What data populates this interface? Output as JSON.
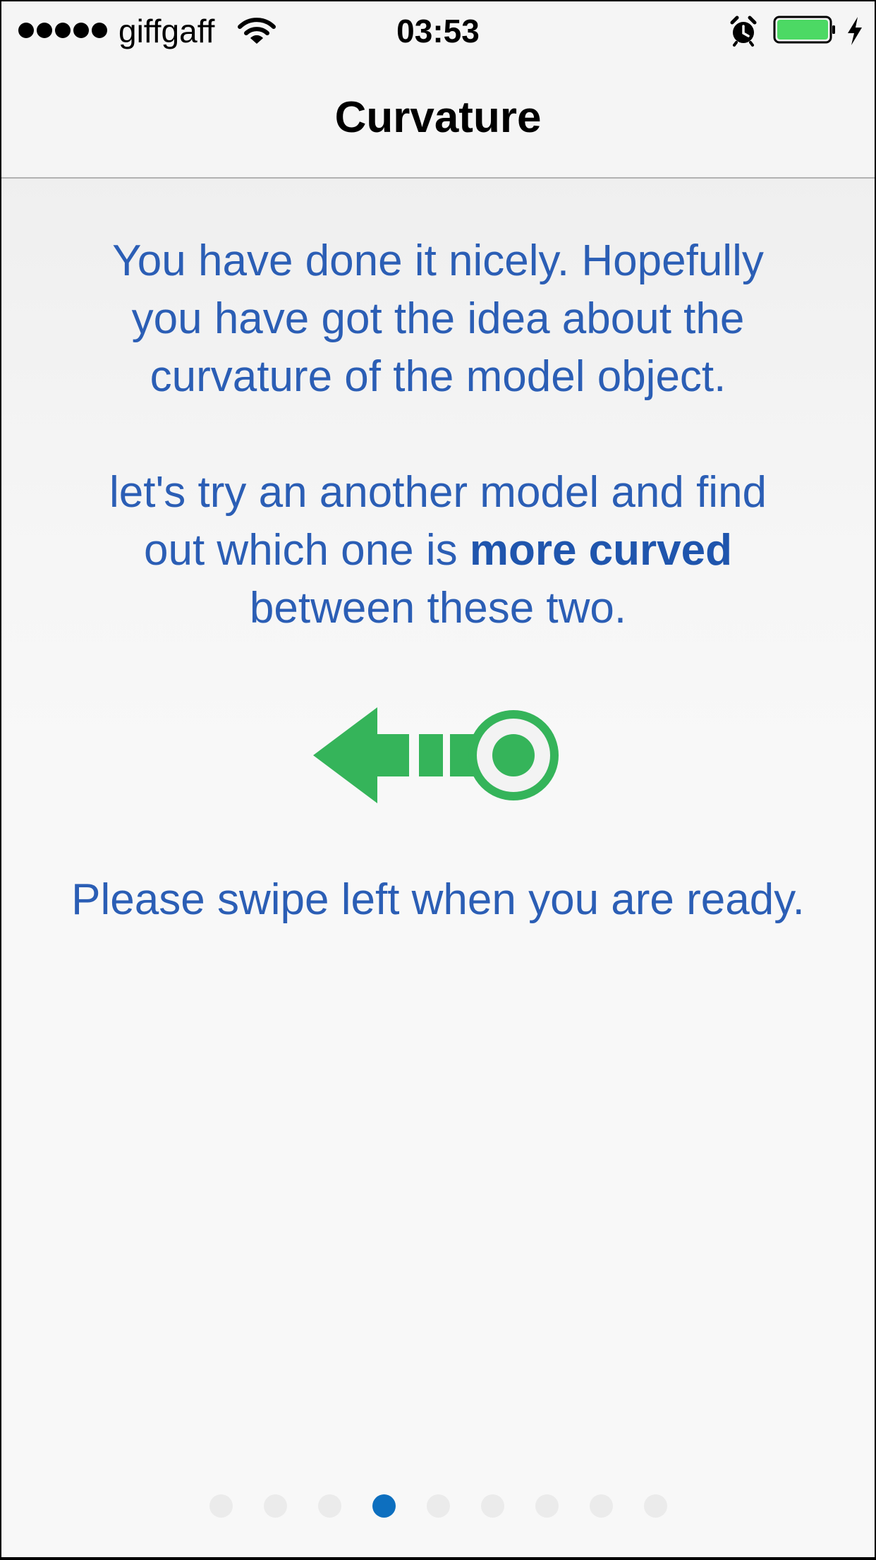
{
  "status_bar": {
    "carrier": "giffgaff",
    "time": "03:53",
    "signal_bars": 5,
    "battery_level": 1.0,
    "icons": [
      "signal-dots-icon",
      "wifi-icon",
      "alarm-clock-icon",
      "battery-icon",
      "charging-bolt-icon"
    ]
  },
  "nav": {
    "title": "Curvature"
  },
  "content": {
    "para1_line1": "You have done it nicely. Hopefully",
    "para1_line2": "you have got the idea about the",
    "para1_line3": "curvature of the model object.",
    "para2_line1": "let's try an another model and find",
    "para2_line2_prefix": "out which one is ",
    "para2_line2_bold": "more curved",
    "para2_line3": "between these two.",
    "swipe_instruction": "Please swipe left when you are ready.",
    "swipe_icon": "swipe-left-arrow-icon",
    "accent_color": "#35b45a",
    "text_color": "#2b5eb5"
  },
  "pager": {
    "total_pages": 9,
    "current_page": 4,
    "active_color": "#0d6fbf"
  }
}
